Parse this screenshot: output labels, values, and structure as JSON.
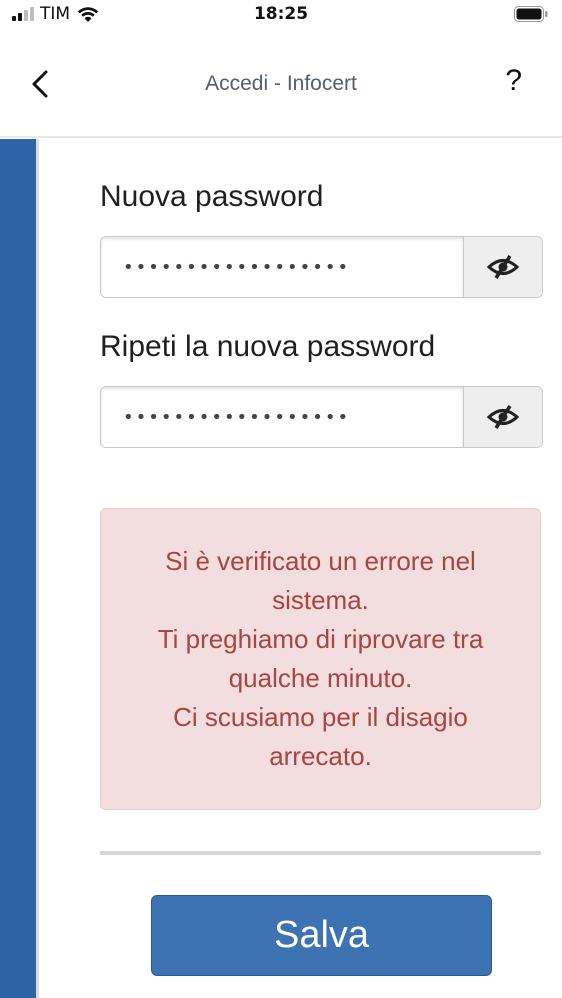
{
  "status_bar": {
    "carrier": "TIM",
    "time": "18:25"
  },
  "header": {
    "title": "Accedi - Infocert",
    "help": "?"
  },
  "form": {
    "new_password_label": "Nuova password",
    "new_password_value": "••••••••••••••••••",
    "repeat_password_label": "Ripeti la nuova password",
    "repeat_password_value": "••••••••••••••••••"
  },
  "error": {
    "lines": [
      "Si è verificato un errore nel",
      "sistema.",
      "Ti preghiamo di riprovare tra",
      "qualche minuto.",
      "Ci scusiamo per il disagio",
      "arrecato."
    ]
  },
  "actions": {
    "save_label": "Salva"
  },
  "colors": {
    "accent": "#3d72b3",
    "sidebar": "#2e63a8",
    "error_bg": "#f2dede",
    "error_text": "#a94442"
  },
  "icons": [
    "signal-icon",
    "wifi-icon",
    "battery-icon",
    "back-chevron-icon",
    "eye-slash-icon"
  ]
}
